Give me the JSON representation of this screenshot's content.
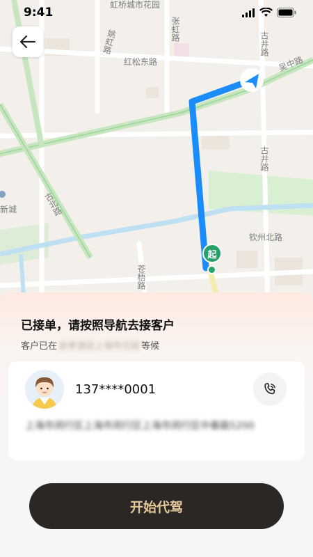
{
  "status_bar": {
    "time": "9:41"
  },
  "map": {
    "road_labels": {
      "hongqiao_garden": "虹桥城市花园",
      "yaohong_road": "姚虹路",
      "zhanghong_road": "张虹路",
      "gujing_road": "古井路",
      "hongsong_east_road": "红松东路",
      "wuzhong_road": "吴中路",
      "gubei_road": "古北路",
      "qinzhou_north_road": "钦州北路",
      "cangwu_road": "苍梧路",
      "xincheng": "新城"
    },
    "start_marker_label": "起",
    "route_color": "#1a8dfa"
  },
  "sheet": {
    "title": "已接单，请按照导航去接客户",
    "subtitle_prefix": "客户已在",
    "subtitle_location": "金孝酒店上海市古田",
    "subtitle_suffix": "等候"
  },
  "customer": {
    "phone": "137****0001",
    "address": "上海市闵行区上海市闵行区上海市闵行区中春路5200"
  },
  "action": {
    "start_label": "开始代驾"
  },
  "colors": {
    "button_bg": "#2b2725",
    "button_text": "#e5c89a",
    "start_marker": "#28a06a"
  }
}
